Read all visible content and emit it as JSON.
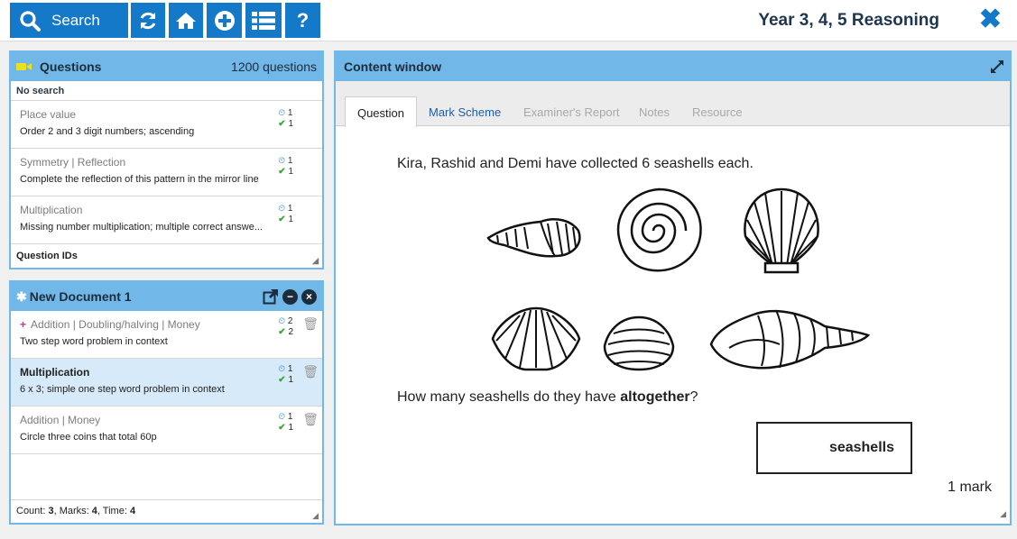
{
  "toolbar": {
    "search_label": "Search",
    "help_label": "?",
    "title": "Year 3, 4, 5 Reasoning",
    "close_label": "✖"
  },
  "questions_panel": {
    "title": "Questions",
    "count": "1200 questions",
    "search_status": "No search",
    "items": [
      {
        "topic": "Place value",
        "desc": "Order 2 and 3 digit numbers; ascending",
        "time": "1",
        "marks": "1"
      },
      {
        "topic": "Symmetry | Reflection",
        "desc": "Complete the reflection of this pattern in the mirror line",
        "time": "1",
        "marks": "1"
      },
      {
        "topic": "Multiplication",
        "desc": "Missing number multiplication; multiple correct answe...",
        "time": "1",
        "marks": "1"
      }
    ],
    "footer": "Question IDs"
  },
  "document_panel": {
    "title": "New Document 1",
    "items": [
      {
        "topic": "Addition | Doubling/halving | Money",
        "desc": "Two step word problem in context",
        "time": "2",
        "marks": "2"
      },
      {
        "topic": "Multiplication",
        "desc": "6 x 3; simple one step word problem in context",
        "time": "1",
        "marks": "1"
      },
      {
        "topic": "Addition | Money",
        "desc": "Circle three coins that total 60p",
        "time": "1",
        "marks": "1"
      }
    ],
    "footer": {
      "count_label": "Count: ",
      "count": "3",
      "marks_label": ", Marks: ",
      "marks": "4",
      "time_label": ", Time: ",
      "time": "4"
    }
  },
  "content_window": {
    "title": "Content window",
    "tabs": [
      "Question",
      "Mark Scheme",
      "Examiner's Report",
      "Notes",
      "Resource"
    ],
    "question": {
      "line1": "Kira, Rashid and Demi have collected 6 seashells each.",
      "line2_prefix": "How many seashells do they have ",
      "line2_bold": "altogether",
      "line2_suffix": "?",
      "answer_unit": "seashells",
      "marks": "1 mark"
    }
  },
  "colors": {
    "toolbar_blue": "#1479c9",
    "panel_header": "#71b8e8",
    "selected_row": "#d6eaf9",
    "add_marker": "#e0268e"
  }
}
